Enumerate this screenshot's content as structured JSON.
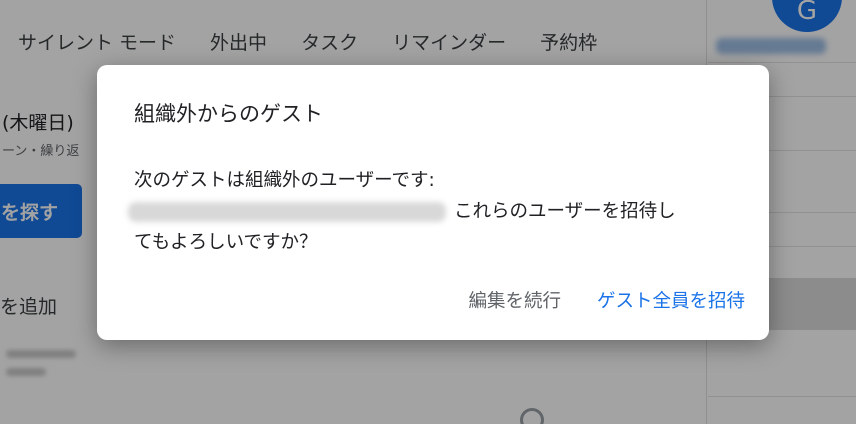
{
  "background": {
    "tabs": [
      "サイレント モード",
      "外出中",
      "タスク",
      "リマインダー",
      "予約枠"
    ],
    "date_fragment": "(木曜日)",
    "subline_fragment": "ーン・繰り返",
    "find_button_fragment": "を探す",
    "add_fragment": "を追加",
    "avatar_letter": "G"
  },
  "dialog": {
    "title": "組織外からのゲスト",
    "body_line1": "次のゲストは組織外のユーザーです:",
    "body_line2_suffix": "これらのユーザーを招待し",
    "body_line3": "てもよろしいですか？",
    "continue_label": "編集を続行",
    "invite_label": "ゲスト全員を招待"
  },
  "colors": {
    "accent": "#1a73e8",
    "secondary_text": "#5f6368"
  }
}
